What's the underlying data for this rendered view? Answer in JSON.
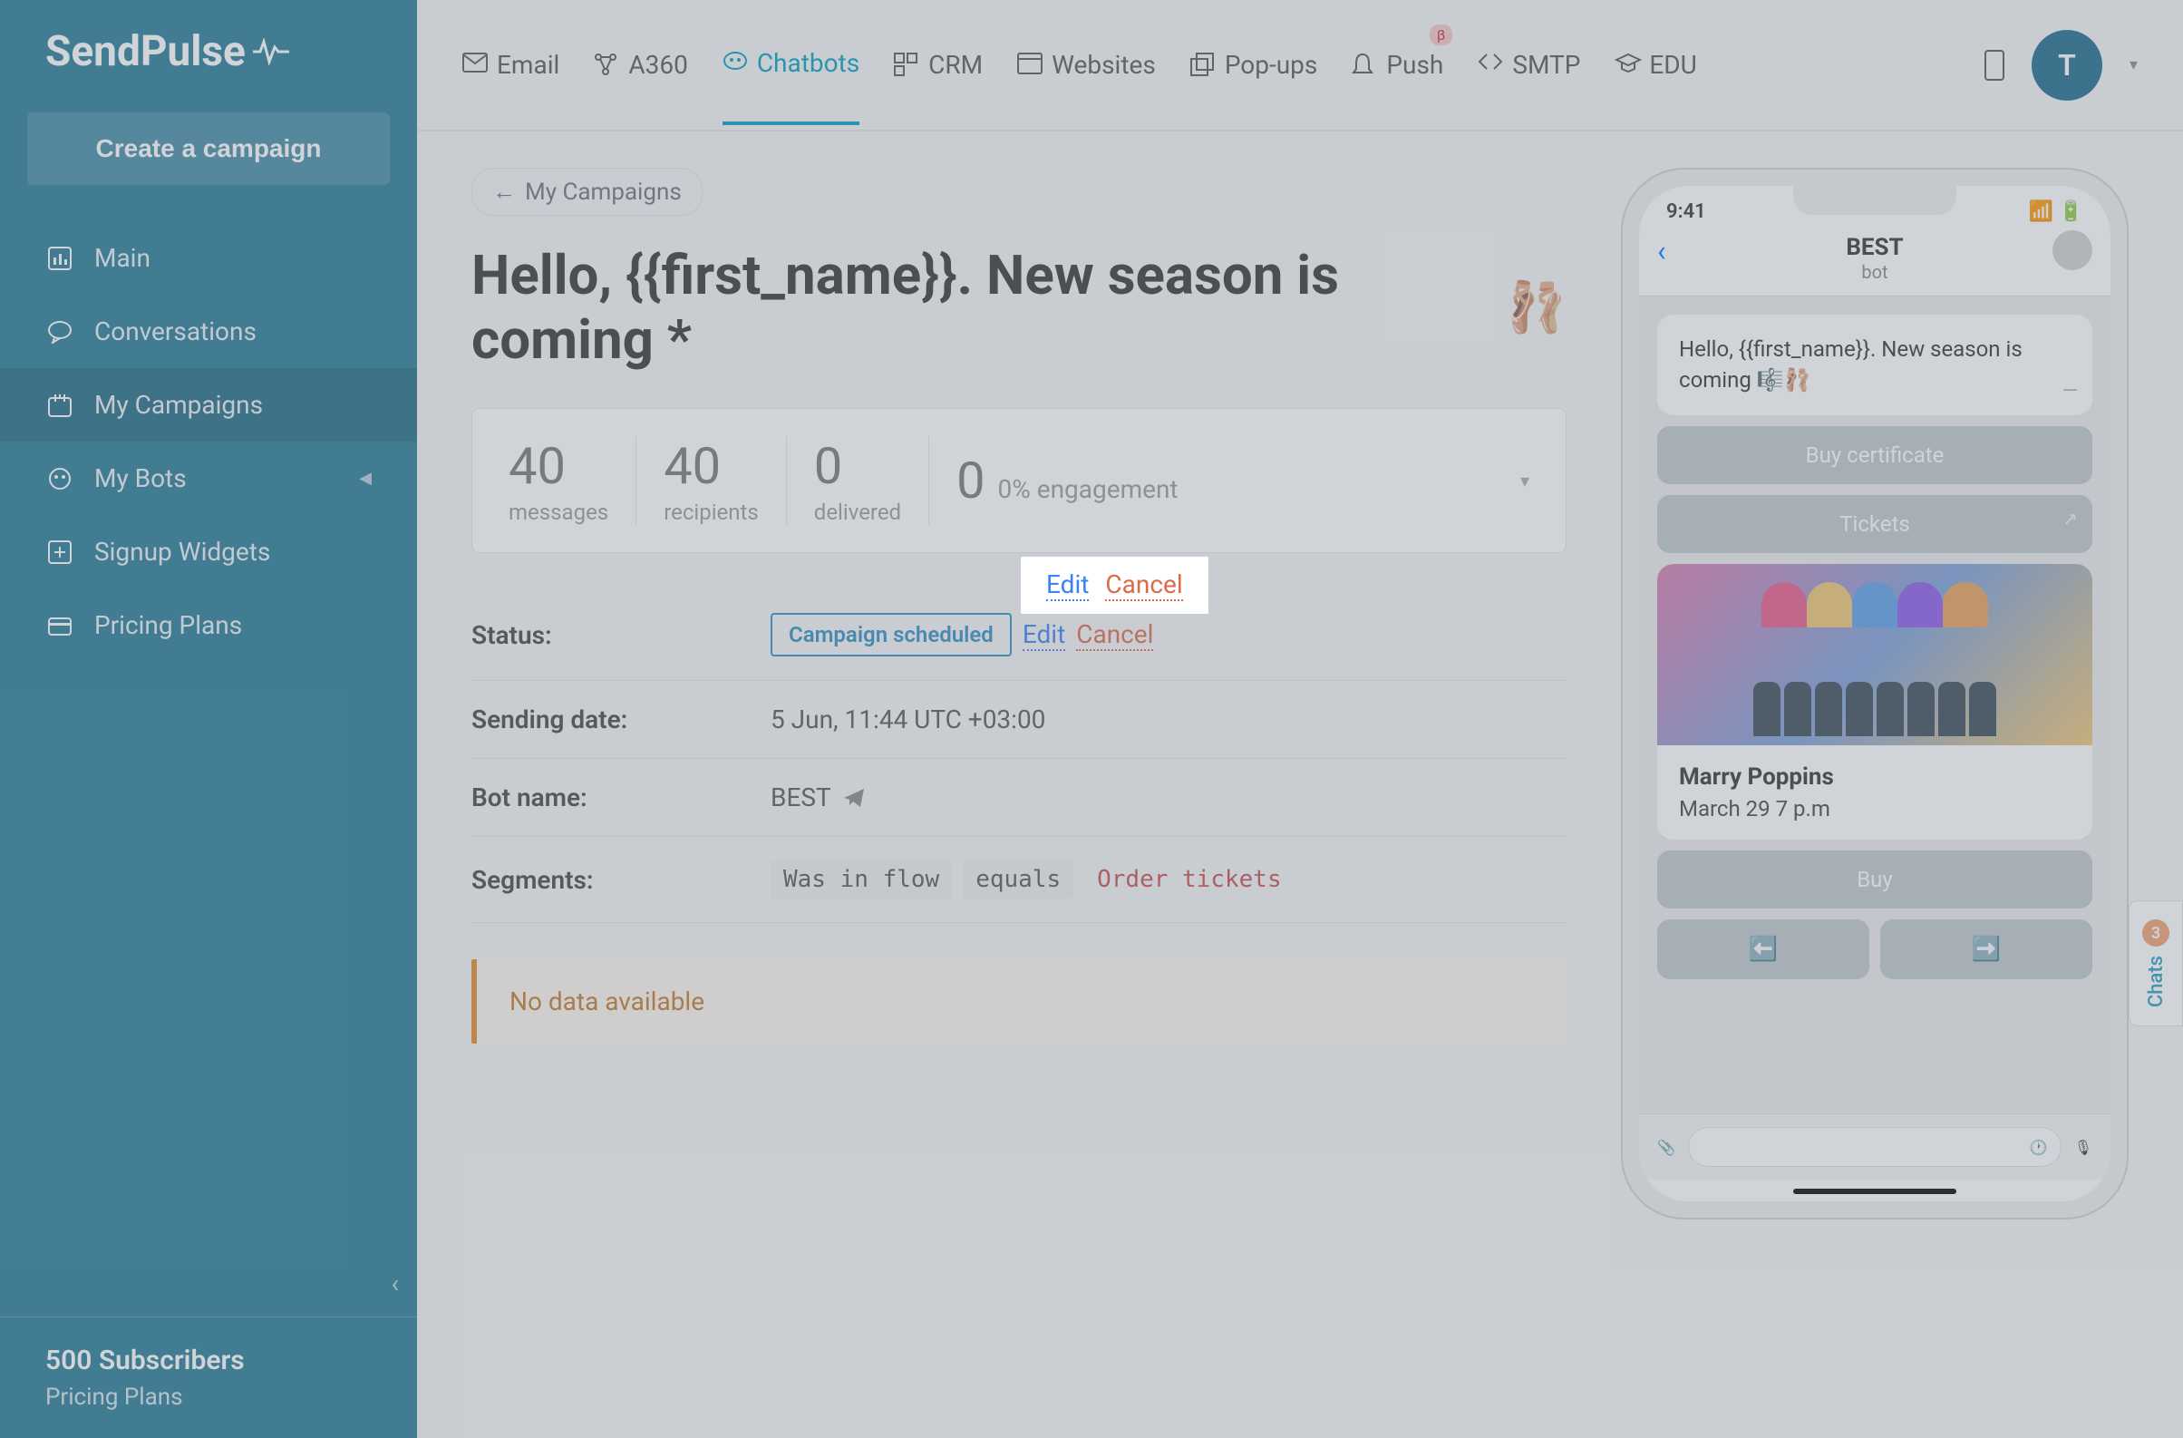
{
  "brand": "SendPulse",
  "sidebar": {
    "create_label": "Create a campaign",
    "items": [
      {
        "label": "Main"
      },
      {
        "label": "Conversations"
      },
      {
        "label": "My Campaigns"
      },
      {
        "label": "My Bots"
      },
      {
        "label": "Signup Widgets"
      },
      {
        "label": "Pricing Plans"
      }
    ],
    "subscribers": "500 Subscribers",
    "plan": "Pricing Plans"
  },
  "topnav": {
    "items": [
      {
        "label": "Email"
      },
      {
        "label": "A360"
      },
      {
        "label": "Chatbots"
      },
      {
        "label": "CRM"
      },
      {
        "label": "Websites"
      },
      {
        "label": "Pop-ups"
      },
      {
        "label": "Push",
        "badge": "β"
      },
      {
        "label": "SMTP"
      },
      {
        "label": "EDU"
      }
    ],
    "avatar_initial": "T"
  },
  "breadcrumb": "My Campaigns",
  "page_title": "Hello, {{first_name}}. New season is coming *",
  "stats": [
    {
      "value": "40",
      "label": "messages"
    },
    {
      "value": "40",
      "label": "recipients"
    },
    {
      "value": "0",
      "label": "delivered"
    },
    {
      "value": "0",
      "label": "0% engagement"
    }
  ],
  "details": {
    "status_label": "Status:",
    "status_value": "Campaign scheduled",
    "edit": "Edit",
    "cancel": "Cancel",
    "sending_label": "Sending date:",
    "sending_value": "5 Jun, 11:44 UTC +03:00",
    "bot_label": "Bot name:",
    "bot_value": "BEST",
    "segments_label": "Segments:",
    "seg_was": "Was in flow",
    "seg_equals": "equals",
    "seg_order": "Order tickets"
  },
  "alert": "No data available",
  "phone": {
    "time": "9:41",
    "title": "BEST",
    "subtitle": "bot",
    "msg": "Hello, {{first_name}}. New season is coming 🎼🩰",
    "btn_cert": "Buy certificate",
    "btn_tickets": "Tickets",
    "card_title": "Marry Poppins",
    "card_sub": "March 29 7 p.m",
    "btn_buy": "Buy",
    "btn_left": "⬅️",
    "btn_right": "➡️"
  },
  "chats_tab": {
    "count": "3",
    "label": "Chats"
  }
}
